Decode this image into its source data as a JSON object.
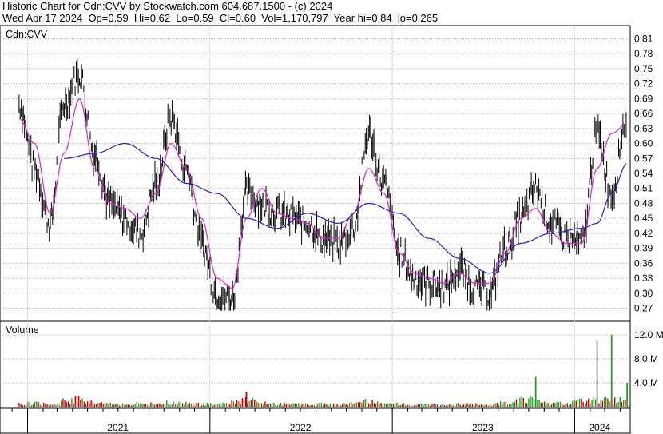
{
  "header": {
    "line1": "Historic Chart for Cdn:CVV by Stockwatch.com 604.687.1500 - (c) 2024",
    "line2": "Wed Apr 17 2024  Op=0.59  Hi=0.62  Lo=0.59  Cl=0.60  Vol=1,170,797  Year hi=0.84  lo=0.265"
  },
  "chart_data": [
    {
      "type": "candlestick",
      "panel_label": "Cdn:CVV",
      "ylim": [
        0.25,
        0.83
      ],
      "y_ticks": [
        "0.81",
        "0.78",
        "0.75",
        "0.72",
        "0.69",
        "0.66",
        "0.63",
        "0.60",
        "0.57",
        "0.54",
        "0.51",
        "0.48",
        "0.45",
        "0.42",
        "0.39",
        "0.36",
        "0.33",
        "0.30",
        "0.27"
      ],
      "x_tick_labels": [
        "2021",
        "2022",
        "2023",
        "2024"
      ],
      "grid": true,
      "series": [
        {
          "name": "",
          "kind": "price",
          "x": [
            "2020-12",
            "2021-01",
            "2021-02",
            "2021-03",
            "2021-04",
            "2021-05",
            "2021-06",
            "2021-07",
            "2021-08",
            "2021-09",
            "2021-10",
            "2021-11",
            "2021-12",
            "2022-01",
            "2022-02",
            "2022-03",
            "2022-04",
            "2022-05",
            "2022-06",
            "2022-07",
            "2022-08",
            "2022-09",
            "2022-10",
            "2022-11",
            "2022-12",
            "2023-01",
            "2023-02",
            "2023-03",
            "2023-04",
            "2023-05",
            "2023-06",
            "2023-07",
            "2023-08",
            "2023-09",
            "2023-10",
            "2023-11",
            "2023-12",
            "2024-01",
            "2024-02",
            "2024-03",
            "2024-04"
          ],
          "values": [
            0.68,
            0.55,
            0.44,
            0.68,
            0.74,
            0.58,
            0.48,
            0.45,
            0.42,
            0.52,
            0.65,
            0.55,
            0.4,
            0.3,
            0.29,
            0.5,
            0.48,
            0.46,
            0.45,
            0.44,
            0.41,
            0.4,
            0.43,
            0.62,
            0.52,
            0.38,
            0.33,
            0.32,
            0.31,
            0.35,
            0.31,
            0.3,
            0.39,
            0.45,
            0.51,
            0.44,
            0.41,
            0.4,
            0.62,
            0.5,
            0.66
          ]
        },
        {
          "name": "",
          "kind": "moving-average-short",
          "color": "#e020d0",
          "x": [
            "2020-12",
            "2021-01",
            "2021-02",
            "2021-03",
            "2021-04",
            "2021-05",
            "2021-06",
            "2021-07",
            "2021-08",
            "2021-09",
            "2021-10",
            "2021-11",
            "2021-12",
            "2022-01",
            "2022-02",
            "2022-03",
            "2022-04",
            "2022-05",
            "2022-06",
            "2022-07",
            "2022-08",
            "2022-09",
            "2022-10",
            "2022-11",
            "2022-12",
            "2023-01",
            "2023-02",
            "2023-03",
            "2023-04",
            "2023-05",
            "2023-06",
            "2023-07",
            "2023-08",
            "2023-09",
            "2023-10",
            "2023-11",
            "2023-12",
            "2024-01",
            "2024-02",
            "2024-03",
            "2024-04"
          ],
          "values": [
            0.65,
            0.6,
            0.46,
            0.58,
            0.69,
            0.55,
            0.48,
            0.47,
            0.45,
            0.5,
            0.6,
            0.55,
            0.45,
            0.33,
            0.31,
            0.45,
            0.51,
            0.46,
            0.45,
            0.44,
            0.41,
            0.41,
            0.46,
            0.55,
            0.5,
            0.38,
            0.34,
            0.33,
            0.32,
            0.34,
            0.32,
            0.32,
            0.38,
            0.45,
            0.47,
            0.42,
            0.4,
            0.4,
            0.55,
            0.62,
            0.64
          ]
        },
        {
          "name": "",
          "kind": "moving-average-long",
          "color": "#2020c0",
          "x": [
            "2021-03",
            "2021-05",
            "2021-07",
            "2021-09",
            "2021-11",
            "2022-01",
            "2022-03",
            "2022-05",
            "2022-07",
            "2022-09",
            "2022-11",
            "2023-01",
            "2023-03",
            "2023-05",
            "2023-07",
            "2023-09",
            "2023-11",
            "2024-01",
            "2024-02",
            "2024-03",
            "2024-04"
          ],
          "values": [
            0.57,
            0.58,
            0.6,
            0.57,
            0.52,
            0.5,
            0.45,
            0.43,
            0.46,
            0.44,
            0.48,
            0.46,
            0.41,
            0.37,
            0.34,
            0.4,
            0.42,
            0.43,
            0.44,
            0.5,
            0.56
          ]
        }
      ]
    },
    {
      "type": "bar",
      "panel_label": "Volume",
      "ylim": [
        0,
        14
      ],
      "y_ticks": [
        "12.0 M",
        "8.0 M",
        "4.0 M"
      ],
      "x_tick_labels": [
        "2021",
        "2022",
        "2023",
        "2024"
      ],
      "series": [
        {
          "name": "",
          "unit": "M",
          "x": [
            "2020-12",
            "2021-01",
            "2021-02",
            "2021-03",
            "2021-04",
            "2021-05",
            "2021-06",
            "2021-07",
            "2021-08",
            "2021-09",
            "2021-10",
            "2021-11",
            "2021-12",
            "2022-01",
            "2022-02",
            "2022-03",
            "2022-04",
            "2022-05",
            "2022-06",
            "2022-07",
            "2022-08",
            "2022-09",
            "2022-10",
            "2022-11",
            "2022-12",
            "2023-01",
            "2023-02",
            "2023-03",
            "2023-04",
            "2023-05",
            "2023-06",
            "2023-07",
            "2023-08",
            "2023-09",
            "2023-10",
            "2023-11",
            "2023-12",
            "2024-01",
            "2024-02",
            "2024-03",
            "2024-04"
          ],
          "values": [
            0.6,
            0.8,
            0.5,
            1.2,
            1.8,
            0.9,
            0.6,
            0.5,
            0.7,
            0.6,
            1.0,
            0.8,
            0.6,
            0.5,
            1.0,
            2.5,
            0.8,
            0.6,
            0.6,
            0.5,
            0.6,
            0.5,
            0.7,
            1.2,
            0.7,
            0.6,
            0.5,
            0.5,
            0.5,
            0.6,
            0.5,
            0.6,
            0.8,
            1.4,
            5.0,
            0.6,
            0.8,
            1.2,
            11.0,
            12.0,
            4.0
          ]
        }
      ]
    }
  ]
}
